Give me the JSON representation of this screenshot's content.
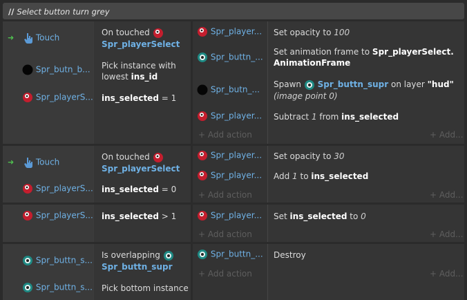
{
  "comment": {
    "prefix": "//",
    "text": "Select button turn grey"
  },
  "events": [
    {
      "conditions": [
        {
          "object": "Touch",
          "icon": "touch-icon",
          "text": [
            "On touched ",
            "Spr_playerSelect"
          ]
        },
        {
          "object": "Spr_butn_b...",
          "icon": "black-sprite-icon",
          "text": [
            "Pick instance with",
            "lowest ",
            "ins_id"
          ]
        },
        {
          "object": "Spr_playerS...",
          "icon": "player-sprite-icon",
          "text": [
            "ins_selected",
            " = 1"
          ]
        }
      ],
      "actions": [
        {
          "object": "Spr_player...",
          "icon": "player-sprite-icon",
          "text": [
            "Set opacity to ",
            "100"
          ]
        },
        {
          "object": "Spr_buttn_...",
          "icon": "eye-sprite-icon",
          "text": [
            "Set animation frame to ",
            "Spr_playerSelect.",
            "AnimationFrame"
          ]
        },
        {
          "object": "Spr_butn_...",
          "icon": "black-sprite-icon",
          "text": [
            "Spawn ",
            "Spr_buttn_supr",
            " on layer ",
            "\"hud\"",
            "(image point 0)"
          ]
        },
        {
          "object": "Spr_player...",
          "icon": "player-sprite-icon",
          "text": [
            "Subtract ",
            "1",
            " from ",
            "ins_selected"
          ]
        }
      ],
      "add_action": "+ Add action",
      "add_short": "+ Add..."
    },
    {
      "conditions": [
        {
          "object": "Touch",
          "icon": "touch-icon",
          "text": [
            "On touched ",
            "Spr_playerSelect"
          ]
        },
        {
          "object": "Spr_playerS...",
          "icon": "player-sprite-icon",
          "text": [
            "ins_selected",
            " = 0"
          ]
        }
      ],
      "actions": [
        {
          "object": "Spr_player...",
          "icon": "player-sprite-icon",
          "text": [
            "Set opacity to ",
            "30"
          ]
        },
        {
          "object": "Spr_player...",
          "icon": "player-sprite-icon",
          "text": [
            "Add ",
            "1",
            " to ",
            "ins_selected"
          ]
        }
      ],
      "add_action": "+ Add action",
      "add_short": "+ Add..."
    },
    {
      "conditions": [
        {
          "object": "Spr_playerS...",
          "icon": "player-sprite-icon",
          "text": [
            "ins_selected",
            " > 1"
          ]
        }
      ],
      "actions": [
        {
          "object": "Spr_player...",
          "icon": "player-sprite-icon",
          "text": [
            "Set ",
            "ins_selected",
            " to ",
            "0"
          ]
        }
      ],
      "add_action": "+ Add action",
      "add_short": "+ Add..."
    },
    {
      "conditions": [
        {
          "object": "Spr_buttn_s...",
          "icon": "eye-sprite-icon",
          "text": [
            "Is overlapping ",
            "Spr_buttn_supr"
          ]
        },
        {
          "object": "Spr_buttn_s...",
          "icon": "eye-sprite-icon",
          "text": [
            "Pick bottom instance"
          ]
        }
      ],
      "actions": [
        {
          "object": "Spr_buttn_...",
          "icon": "eye-sprite-icon",
          "text": [
            "Destroy"
          ]
        }
      ],
      "add_action": "+ Add action",
      "add_short": "+ Add..."
    }
  ],
  "colors": {
    "object_link": "#6fb1e5",
    "trigger_arrow": "#4fbf4f",
    "background": "#2b2b2b"
  }
}
